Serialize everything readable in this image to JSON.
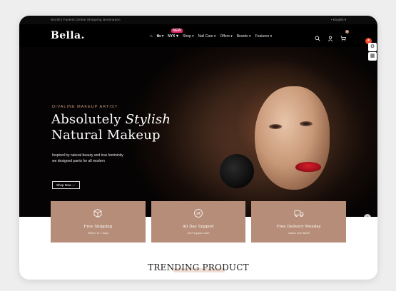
{
  "topbar": {
    "announcement": "World's Fastest Online Shopping Destination",
    "language": "English"
  },
  "header": {
    "logo": "Bella.",
    "nav": {
      "brand1": "tb",
      "brand2": "NYX",
      "new_badge": "NEW",
      "shop": "Shop",
      "nail_care": "Nail Care",
      "offers": "Offers",
      "brands": "Brands",
      "features": "Features"
    },
    "cart_count": "0"
  },
  "hero": {
    "tagline": "DIVALINE MAKEUP ARTIST",
    "heading_plain_1": "Absolutely ",
    "heading_italic": "Stylish",
    "heading_line_2": "Natural Makeup",
    "paragraph_line_1": "Inspired by natural beauty and true femininity",
    "paragraph_line_2": "we designed parris for all modern",
    "cta": "Shop Now"
  },
  "features": [
    {
      "title": "Free Shipping",
      "subtitle": "Return in 7 days",
      "icon": "box-icon"
    },
    {
      "title": "All Day Support",
      "subtitle": "24/7 support care",
      "icon": "support-icon"
    },
    {
      "title": "Free Delivery Monday",
      "subtitle": "orders over $499",
      "icon": "truck-icon"
    }
  ],
  "trending": {
    "title": "TRENDING PRODUCT"
  },
  "colors": {
    "accent": "#b68d78",
    "tag": "#c89a7e",
    "header_bg": "#000000",
    "lips": "#c01822"
  }
}
